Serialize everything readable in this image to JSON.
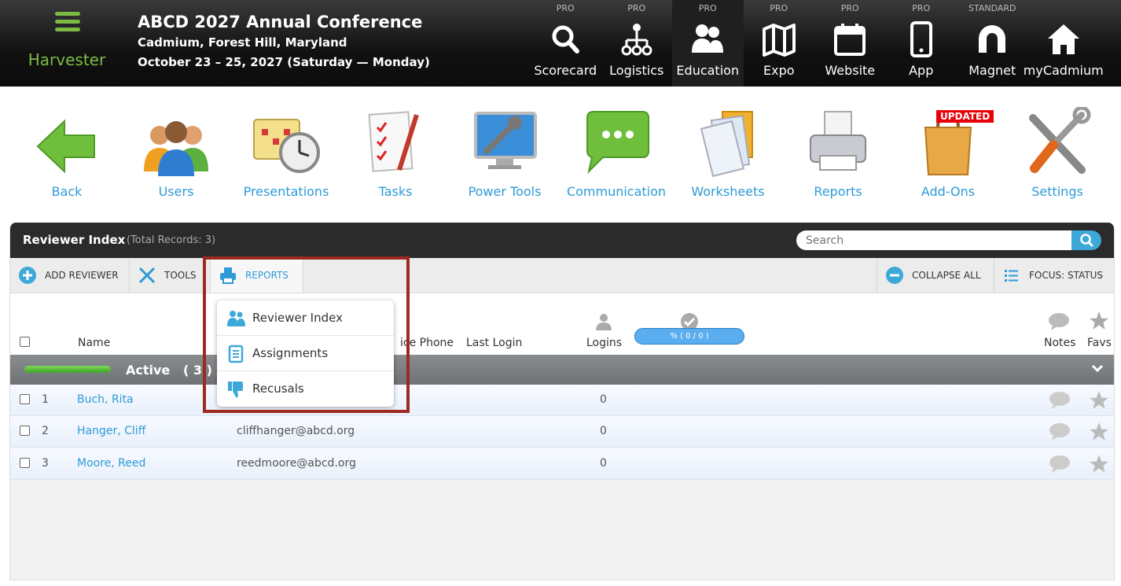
{
  "brand": {
    "name": "Harvester"
  },
  "conference": {
    "title": "ABCD 2027 Annual Conference",
    "location": "Cadmium, Forest Hill, Maryland",
    "dates": "October 23 – 25, 2027 (Saturday — Monday)"
  },
  "topnav": [
    {
      "tier": "PRO",
      "label": "Scorecard",
      "icon": "search-icon"
    },
    {
      "tier": "PRO",
      "label": "Logistics",
      "icon": "hierarchy-icon"
    },
    {
      "tier": "PRO",
      "label": "Education",
      "icon": "users-icon",
      "active": true
    },
    {
      "tier": "PRO",
      "label": "Expo",
      "icon": "map-icon"
    },
    {
      "tier": "PRO",
      "label": "Website",
      "icon": "calendar-icon"
    },
    {
      "tier": "PRO",
      "label": "App",
      "icon": "phone-icon"
    },
    {
      "tier": "STANDARD",
      "label": "Magnet",
      "icon": "magnet-icon"
    },
    {
      "tier": "",
      "label": "myCadmium",
      "icon": "home-icon"
    }
  ],
  "iconrow": [
    {
      "label": "Back",
      "icon": "back-arrow-icon"
    },
    {
      "label": "Users",
      "icon": "users-group-icon"
    },
    {
      "label": "Presentations",
      "icon": "calendar-clock-icon"
    },
    {
      "label": "Tasks",
      "icon": "checklist-icon"
    },
    {
      "label": "Power Tools",
      "icon": "monitor-wrench-icon"
    },
    {
      "label": "Communication",
      "icon": "chat-bubble-icon"
    },
    {
      "label": "Worksheets",
      "icon": "documents-icon"
    },
    {
      "label": "Reports",
      "icon": "printer-icon"
    },
    {
      "label": "Add-Ons",
      "icon": "shopping-bag-icon",
      "badge": "UPDATED"
    },
    {
      "label": "Settings",
      "icon": "tools-icon"
    }
  ],
  "panel": {
    "title": "Reviewer Index",
    "count": "(Total Records: 3)",
    "search_placeholder": "Search"
  },
  "toolbar": {
    "add": "ADD REVIEWER",
    "tools": "TOOLS",
    "reports": "REPORTS",
    "collapse": "COLLAPSE ALL",
    "focus": "FOCUS: STATUS"
  },
  "columns": {
    "name": "Name",
    "phone": "Office Phone",
    "phone_visible": "ice Phone",
    "last_login": "Last Login",
    "logins": "Logins",
    "progress": "% ( 0 / 0 )",
    "notes": "Notes",
    "favs": "Favs"
  },
  "group": {
    "label": "Active",
    "count": "( 3 )"
  },
  "rows": [
    {
      "num": "1",
      "name": "Buch, Rita",
      "email": "",
      "logins": "0"
    },
    {
      "num": "2",
      "name": "Hanger, Cliff",
      "email": "cliffhanger@abcd.org",
      "logins": "0"
    },
    {
      "num": "3",
      "name": "Moore, Reed",
      "email": "reedmoore@abcd.org",
      "logins": "0"
    }
  ],
  "dropdown": [
    {
      "label": "Reviewer Index",
      "icon": "reviewers-icon"
    },
    {
      "label": "Assignments",
      "icon": "document-list-icon"
    },
    {
      "label": "Recusals",
      "icon": "thumbs-down-icon"
    }
  ],
  "colors": {
    "accent": "#2d9bd6",
    "brand_green": "#7bbb44",
    "highlight": "#9c2a22"
  }
}
